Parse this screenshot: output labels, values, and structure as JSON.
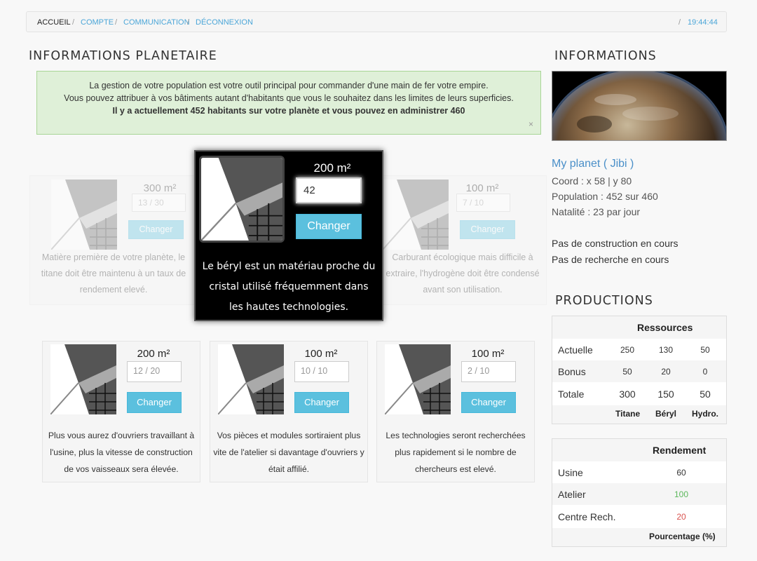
{
  "breadcrumb": {
    "items": [
      "ACCUEIL",
      "COMPTE",
      "COMMUNICATION",
      "DÉCONNEXION"
    ],
    "separator": "/",
    "time": "19:44:44"
  },
  "headings": {
    "main": "INFORMATIONS PLANETAIRE",
    "info": "INFORMATIONS",
    "productions": "PRODUCTIONS"
  },
  "alert": {
    "line1": "La gestion de votre population est votre outil principal pour commander d'une main de fer votre empire.",
    "line2": "Vous pouvez attribuer à vos bâtiments autant d'habitants que vous le souhaitez dans les limites de leurs superficies.",
    "line3": "Il y a actuellement 452 habitants sur votre planète et vous pouvez en administrer 460",
    "close": "×"
  },
  "buildings": {
    "titane": {
      "area": "300 m²",
      "value": "13 / 30",
      "button": "Changer",
      "desc": "Matière première de votre planète, le titane doit être maintenu à un taux de rendement elevé."
    },
    "beryl": {
      "area": "200 m²",
      "value": "42",
      "button": "Changer",
      "desc": "Le béryl est un matériau proche du cristal utilisé fréquemment dans les hautes technologies."
    },
    "hydrogene": {
      "area": "100 m²",
      "value": "7 / 10",
      "button": "Changer",
      "desc": "Carburant écologique mais difficile à extraire, l'hydrogène doit être condensé avant son utilisation."
    },
    "usine": {
      "area": "200 m²",
      "value": "12 / 20",
      "button": "Changer",
      "desc": "Plus vous aurez d'ouvriers travaillant à l'usine, plus la vitesse de construction de vos vaisseaux sera élevée."
    },
    "atelier": {
      "area": "100 m²",
      "value": "10 / 10",
      "button": "Changer",
      "desc": "Vos pièces et modules sortiraient plus vite de l'atelier si davantage d'ouvriers y était affilié."
    },
    "centre": {
      "area": "100 m²",
      "value": "2 / 10",
      "button": "Changer",
      "desc": "Les technologies seront recherchées plus rapidement si le nombre de chercheurs est elevé."
    }
  },
  "planet": {
    "name": "My planet ( Jibi )",
    "coord": "Coord : x 58 | y 80",
    "population": "Population : 452 sur 460",
    "natalite": "Natalité : 23 par jour",
    "construction": "Pas de construction en cours",
    "recherche": "Pas de recherche en cours"
  },
  "ressources": {
    "header": "Ressources",
    "rows": [
      {
        "label": "Actuelle",
        "values": [
          "250",
          "130",
          "50"
        ]
      },
      {
        "label": "Bonus",
        "values": [
          "50",
          "20",
          "0"
        ]
      },
      {
        "label": "Totale",
        "values": [
          "300",
          "150",
          "50"
        ]
      }
    ],
    "columns": [
      "Titane",
      "Béryl",
      "Hydro."
    ]
  },
  "rendement": {
    "header": "Rendement",
    "rows": [
      {
        "label": "Usine",
        "value": "60",
        "color": "#333333"
      },
      {
        "label": "Atelier",
        "value": "100",
        "color": "#5cb85c"
      },
      {
        "label": "Centre Rech.",
        "value": "20",
        "color": "#d9534f"
      }
    ],
    "footer": "Pourcentage (%)"
  },
  "colors": {
    "accent": "#5bc0de",
    "link": "#4ba6d8",
    "alert_bg": "#dff0d8"
  }
}
